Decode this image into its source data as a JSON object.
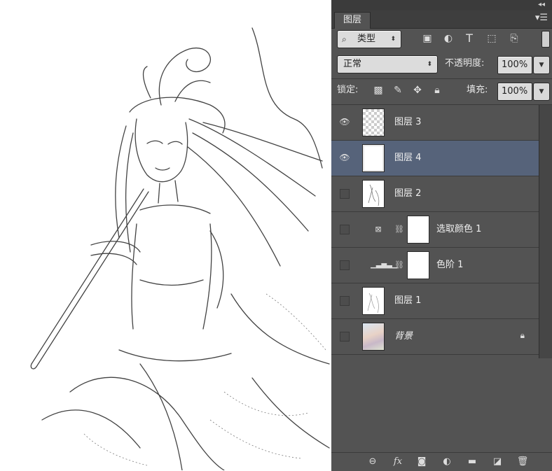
{
  "panel": {
    "tab_label": "图层",
    "menu_icon": "panel-menu-icon",
    "collapse_icon": "double-chevron-right-icon"
  },
  "filter": {
    "search_icon": "search-icon",
    "kind_value": "类型",
    "filter_icons": [
      "image-filter-icon",
      "adjustment-filter-icon",
      "type-filter-icon",
      "shape-filter-icon",
      "smart-object-filter-icon"
    ]
  },
  "blend": {
    "mode_value": "正常",
    "opacity_label": "不透明度:",
    "opacity_value": "100%"
  },
  "lock": {
    "label": "锁定:",
    "fill_label": "填充:",
    "fill_value": "100%"
  },
  "layers": [
    {
      "name": "图层 3",
      "visible": true,
      "thumb": "transparent",
      "selected": false
    },
    {
      "name": "图层 4",
      "visible": true,
      "thumb": "white",
      "selected": true
    },
    {
      "name": "图层 2",
      "visible": false,
      "thumb": "sketch",
      "selected": false
    },
    {
      "name": "选取颜色 1",
      "visible": false,
      "thumb": "adjustment",
      "selected": false
    },
    {
      "name": "色阶 1",
      "visible": false,
      "thumb": "adjustment",
      "selected": false
    },
    {
      "name": "图层 1",
      "visible": false,
      "thumb": "sketch",
      "selected": false
    },
    {
      "name": "背景",
      "visible": false,
      "thumb": "color-art",
      "selected": false,
      "locked": true
    }
  ],
  "bottom_icons": [
    "link-layers-icon",
    "fx-icon",
    "add-mask-icon",
    "new-adjustment-icon",
    "new-group-icon",
    "new-layer-icon",
    "trash-icon"
  ],
  "bottom_fx_label": "fx"
}
